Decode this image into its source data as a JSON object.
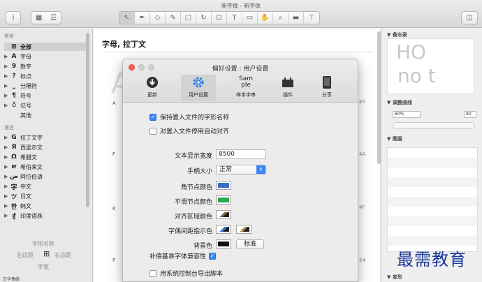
{
  "window": {
    "title": "新字体 - 新字体"
  },
  "sidebar": {
    "section_category": "类型",
    "categories": [
      {
        "glyph": "⊞",
        "label": "全部",
        "selected": true
      },
      {
        "glyph": "A",
        "label": "字母"
      },
      {
        "glyph": "9",
        "label": "数字"
      },
      {
        "glyph": "?",
        "label": "标点"
      },
      {
        "glyph": "⎵",
        "label": "分隔符"
      },
      {
        "glyph": "¶",
        "label": "符号"
      },
      {
        "glyph": "♁",
        "label": "记号"
      },
      {
        "glyph": "",
        "label": "其他"
      }
    ],
    "section_language": "语言",
    "languages": [
      {
        "glyph": "G",
        "label": "拉丁文字"
      },
      {
        "glyph": "Я",
        "label": "西里尔文"
      },
      {
        "glyph": "Ω",
        "label": "希腊文"
      },
      {
        "glyph": "ש",
        "label": "希伯来文"
      },
      {
        "glyph": "ض",
        "label": "阿拉伯语"
      },
      {
        "glyph": "字",
        "label": "中文"
      },
      {
        "glyph": "ツ",
        "label": "日文"
      },
      {
        "glyph": "한",
        "label": "韩文"
      },
      {
        "glyph": "ई",
        "label": "印度语族"
      }
    ],
    "metrics": {
      "name_label": "字形名称",
      "left_label": "左边距",
      "right_label": "右边距",
      "width_label": "字宽",
      "bottom_label": "左字偶组"
    }
  },
  "content": {
    "category_title": "字母, 拉丁文",
    "row_letters": [
      "A",
      "F",
      "K",
      "P"
    ],
    "row_codes": [
      "45",
      "4A",
      "4F",
      "54"
    ],
    "big_glyph": "A"
  },
  "inspector": {
    "memo_label": "备忘录",
    "preview_text_1": "HO",
    "preview_text_2": "no t",
    "curve_label": "调整曲线",
    "curve_value": "60%",
    "curve_number": "80",
    "layers_label": "图层",
    "transform_label": "变形"
  },
  "dialog": {
    "title": "偏好设置 : 用户设置",
    "tabs": [
      {
        "label": "更新",
        "icon": "update-icon"
      },
      {
        "label": "用户设置",
        "icon": "gear-icon",
        "active": true
      },
      {
        "label": "样本字串",
        "icon": "sample-text-icon",
        "icon_text_1": "Sam",
        "icon_text_2": "ple"
      },
      {
        "label": "插件",
        "icon": "plugin-icon"
      },
      {
        "label": "分享",
        "icon": "share-icon"
      }
    ],
    "keep_names_label": "保持置入文件的字形名称",
    "keep_names_checked": true,
    "disable_autoalign_label": "对置入文件停用自动对齐",
    "disable_autoalign_checked": false,
    "text_size_label": "文本显示宽度",
    "text_size_value": "8500",
    "handle_size_label": "手柄大小",
    "handle_size_value": "正常",
    "node_color_label": "角节点颜色",
    "smooth_color_label": "平滑节点颜色",
    "align_color_label": "对齐区域颜色",
    "kern_color_label": "字偶间距指示色",
    "bg_color_label": "背景色",
    "standard_button": "标准",
    "compat_label": "补偿基准字体兼容性",
    "compat_checked": true,
    "console_label": "用系统控制台导出脚本",
    "console_checked": false,
    "colors": {
      "corner": "#3a6cc8",
      "smooth": "#2fa84a",
      "background": "#111111",
      "accent": "#3b86f4"
    }
  },
  "watermark": "最需教育"
}
